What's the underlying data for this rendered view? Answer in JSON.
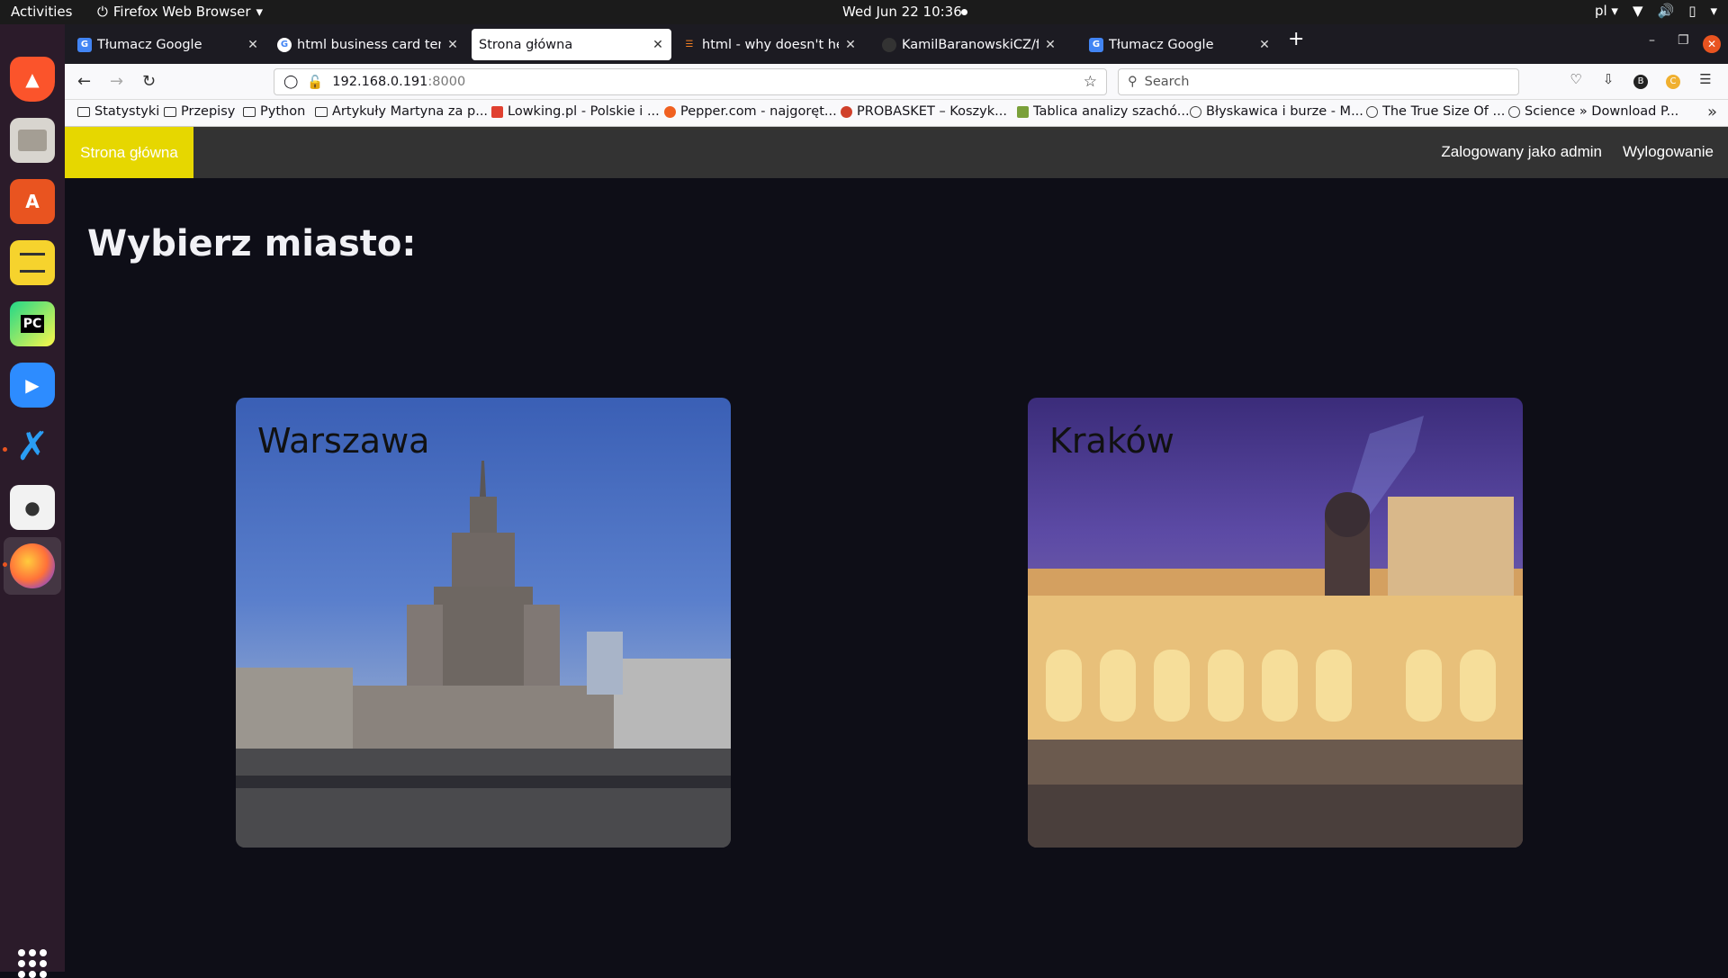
{
  "topbar": {
    "activities": "Activities",
    "app_name": "Firefox Web Browser",
    "clock": "Wed Jun 22  10:36",
    "lang": "pl"
  },
  "tabs": [
    {
      "label": "Tłumacz Google",
      "icon": "google-translate-icon",
      "active": false
    },
    {
      "label": "html business card templ",
      "icon": "google-icon",
      "active": false
    },
    {
      "label": "Strona główna",
      "icon": "",
      "active": true
    },
    {
      "label": "html - why doesn't height",
      "icon": "stackoverflow-icon",
      "active": false
    },
    {
      "label": "KamilBaranowskiCZ/final",
      "icon": "github-icon",
      "active": false
    },
    {
      "label": "Tłumacz Google",
      "icon": "google-translate-icon",
      "active": false
    }
  ],
  "urlbar": {
    "host": "192.168.0.191",
    "port": ":8000"
  },
  "searchbar": {
    "placeholder": "Search"
  },
  "bookmarks": [
    {
      "label": "Statystyki",
      "type": "folder"
    },
    {
      "label": "Przepisy",
      "type": "folder"
    },
    {
      "label": "Python",
      "type": "folder"
    },
    {
      "label": "Artykuły Martyna za p...",
      "type": "folder"
    },
    {
      "label": "Lowking.pl - Polskie i ...",
      "type": "link",
      "color": "#e04030"
    },
    {
      "label": "Pepper.com - najgoręt...",
      "type": "link",
      "color": "#f06020"
    },
    {
      "label": "PROBASKET – Koszyk...",
      "type": "link",
      "color": "#d0402a"
    },
    {
      "label": "Tablica analizy szachó...",
      "type": "link",
      "color": "#7aa03a"
    },
    {
      "label": "Błyskawica i burze - M...",
      "type": "link",
      "color": "#444444"
    },
    {
      "label": "The True Size Of ...",
      "type": "link",
      "color": "#444444"
    },
    {
      "label": "Science » Download P...",
      "type": "link",
      "color": "#444444"
    }
  ],
  "site": {
    "nav_home": "Strona główna",
    "nav_user": "Zalogowany jako admin",
    "nav_logout": "Wylogowanie",
    "title": "Wybierz miasto:",
    "cities": [
      {
        "name": "Warszawa"
      },
      {
        "name": "Kraków"
      }
    ]
  },
  "colors": {
    "page_bg": "#0e0e17",
    "nav_bg": "#333333",
    "nav_home_bg": "#e6d700",
    "accent_close": "#e95420"
  }
}
